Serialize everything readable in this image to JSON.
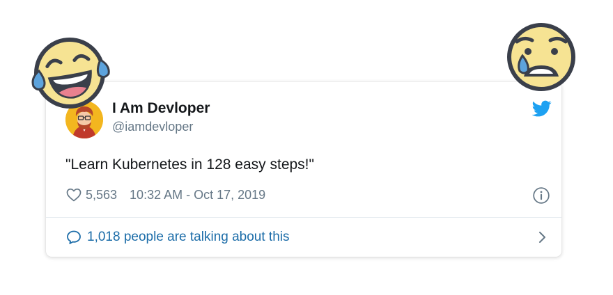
{
  "tweet": {
    "author_name": "I Am Devloper",
    "author_handle": "@iamdevloper",
    "text": "\"Learn Kubernetes in 128 easy steps!\"",
    "likes": "5,563",
    "timestamp": "10:32 AM - Oct 17, 2019",
    "talking_text": "1,018 people are talking about this"
  },
  "icons": {
    "brand": "twitter-bird-icon",
    "like": "heart-icon",
    "info": "info-icon",
    "reply": "speech-bubble-icon",
    "more": "chevron-right-icon"
  },
  "decorations": {
    "left_emoji": "tears-of-joy-emoji",
    "right_emoji": "anguished-crying-emoji"
  },
  "colors": {
    "twitter_blue": "#1da1f2",
    "link_blue": "#1b6ca8",
    "secondary_text": "#657786",
    "primary_text": "#14171a",
    "emoji_yellow": "#f6e393",
    "tear_blue": "#5da3dc"
  }
}
